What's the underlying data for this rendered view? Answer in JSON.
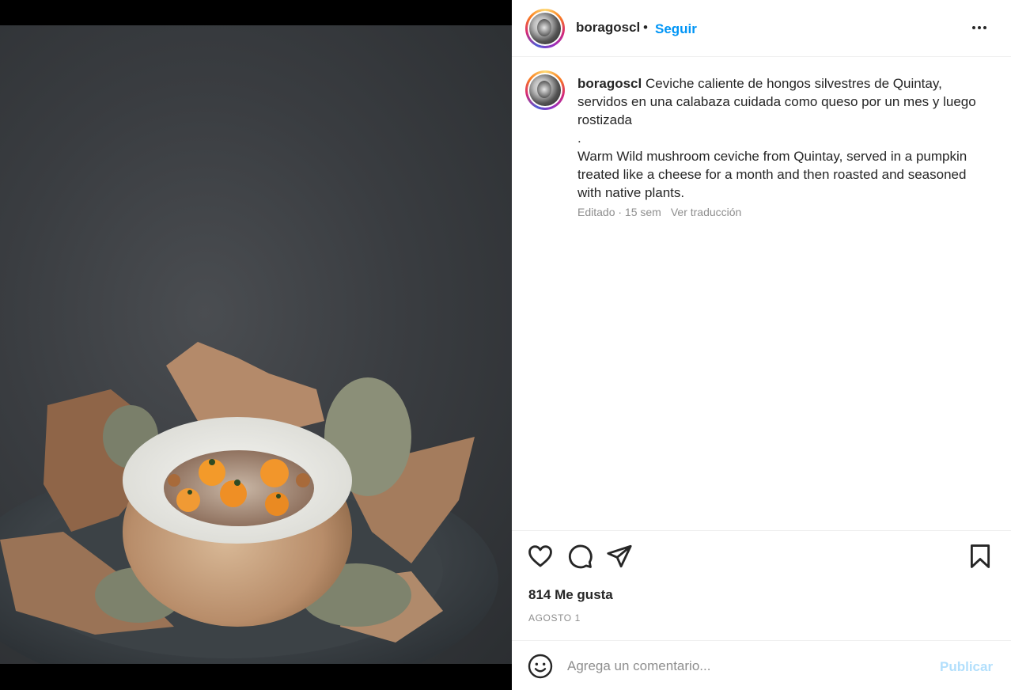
{
  "post": {
    "username": "boragoscl",
    "follow_label": "Seguir",
    "caption_user": "boragoscl",
    "caption_es": "Ceviche caliente de hongos silvestres de Quintay, servidos en una calabaza cuidada como queso por un mes y luego rostizada",
    "caption_sep": ".",
    "caption_en": "Warm Wild mushroom ceviche from Quintay, served in a pumpkin treated like a cheese for a month and then roasted and seasoned with native plants.",
    "meta_edited": "Editado · 15 sem",
    "translate_label": "Ver traducción",
    "likes": "814 Me gusta",
    "date": "AGOSTO 1"
  },
  "comment": {
    "placeholder": "Agrega un comentario...",
    "publish_label": "Publicar"
  },
  "icons": {
    "like": "heart-icon",
    "comment": "comment-icon",
    "share": "paper-plane-icon",
    "save": "bookmark-icon",
    "more": "more-dots-icon",
    "emoji": "emoji-icon"
  },
  "colors": {
    "follow": "#0095f6",
    "publish_disabled": "#b2dffc",
    "meta": "#8e8e8e",
    "text": "#262626"
  }
}
